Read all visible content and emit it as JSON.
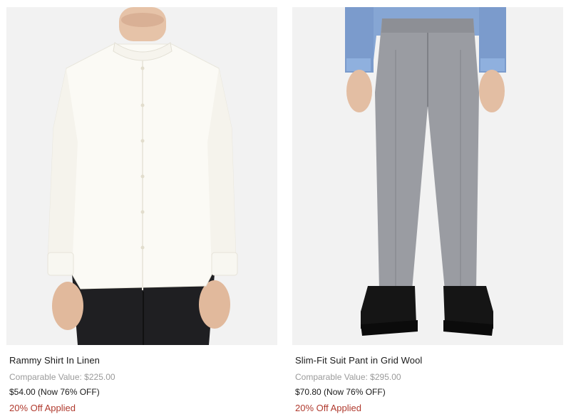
{
  "products": [
    {
      "name": "Rammy Shirt In Linen",
      "comparable_value": "Comparable Value: $225.00",
      "price": "$54.00 (Now 76% OFF)",
      "promo": "20% Off Applied",
      "image_icon": "white-linen-shirt-image"
    },
    {
      "name": "Slim-Fit Suit Pant in Grid Wool",
      "comparable_value": "Comparable Value: $295.00",
      "price": "$70.80 (Now 76% OFF)",
      "promo": "20% Off Applied",
      "image_icon": "grey-suit-pant-image"
    }
  ],
  "colors": {
    "promo": "#b03a2e",
    "muted": "#9a9a9a",
    "text": "#1a1a1a",
    "image_bg": "#f2f2f2"
  }
}
